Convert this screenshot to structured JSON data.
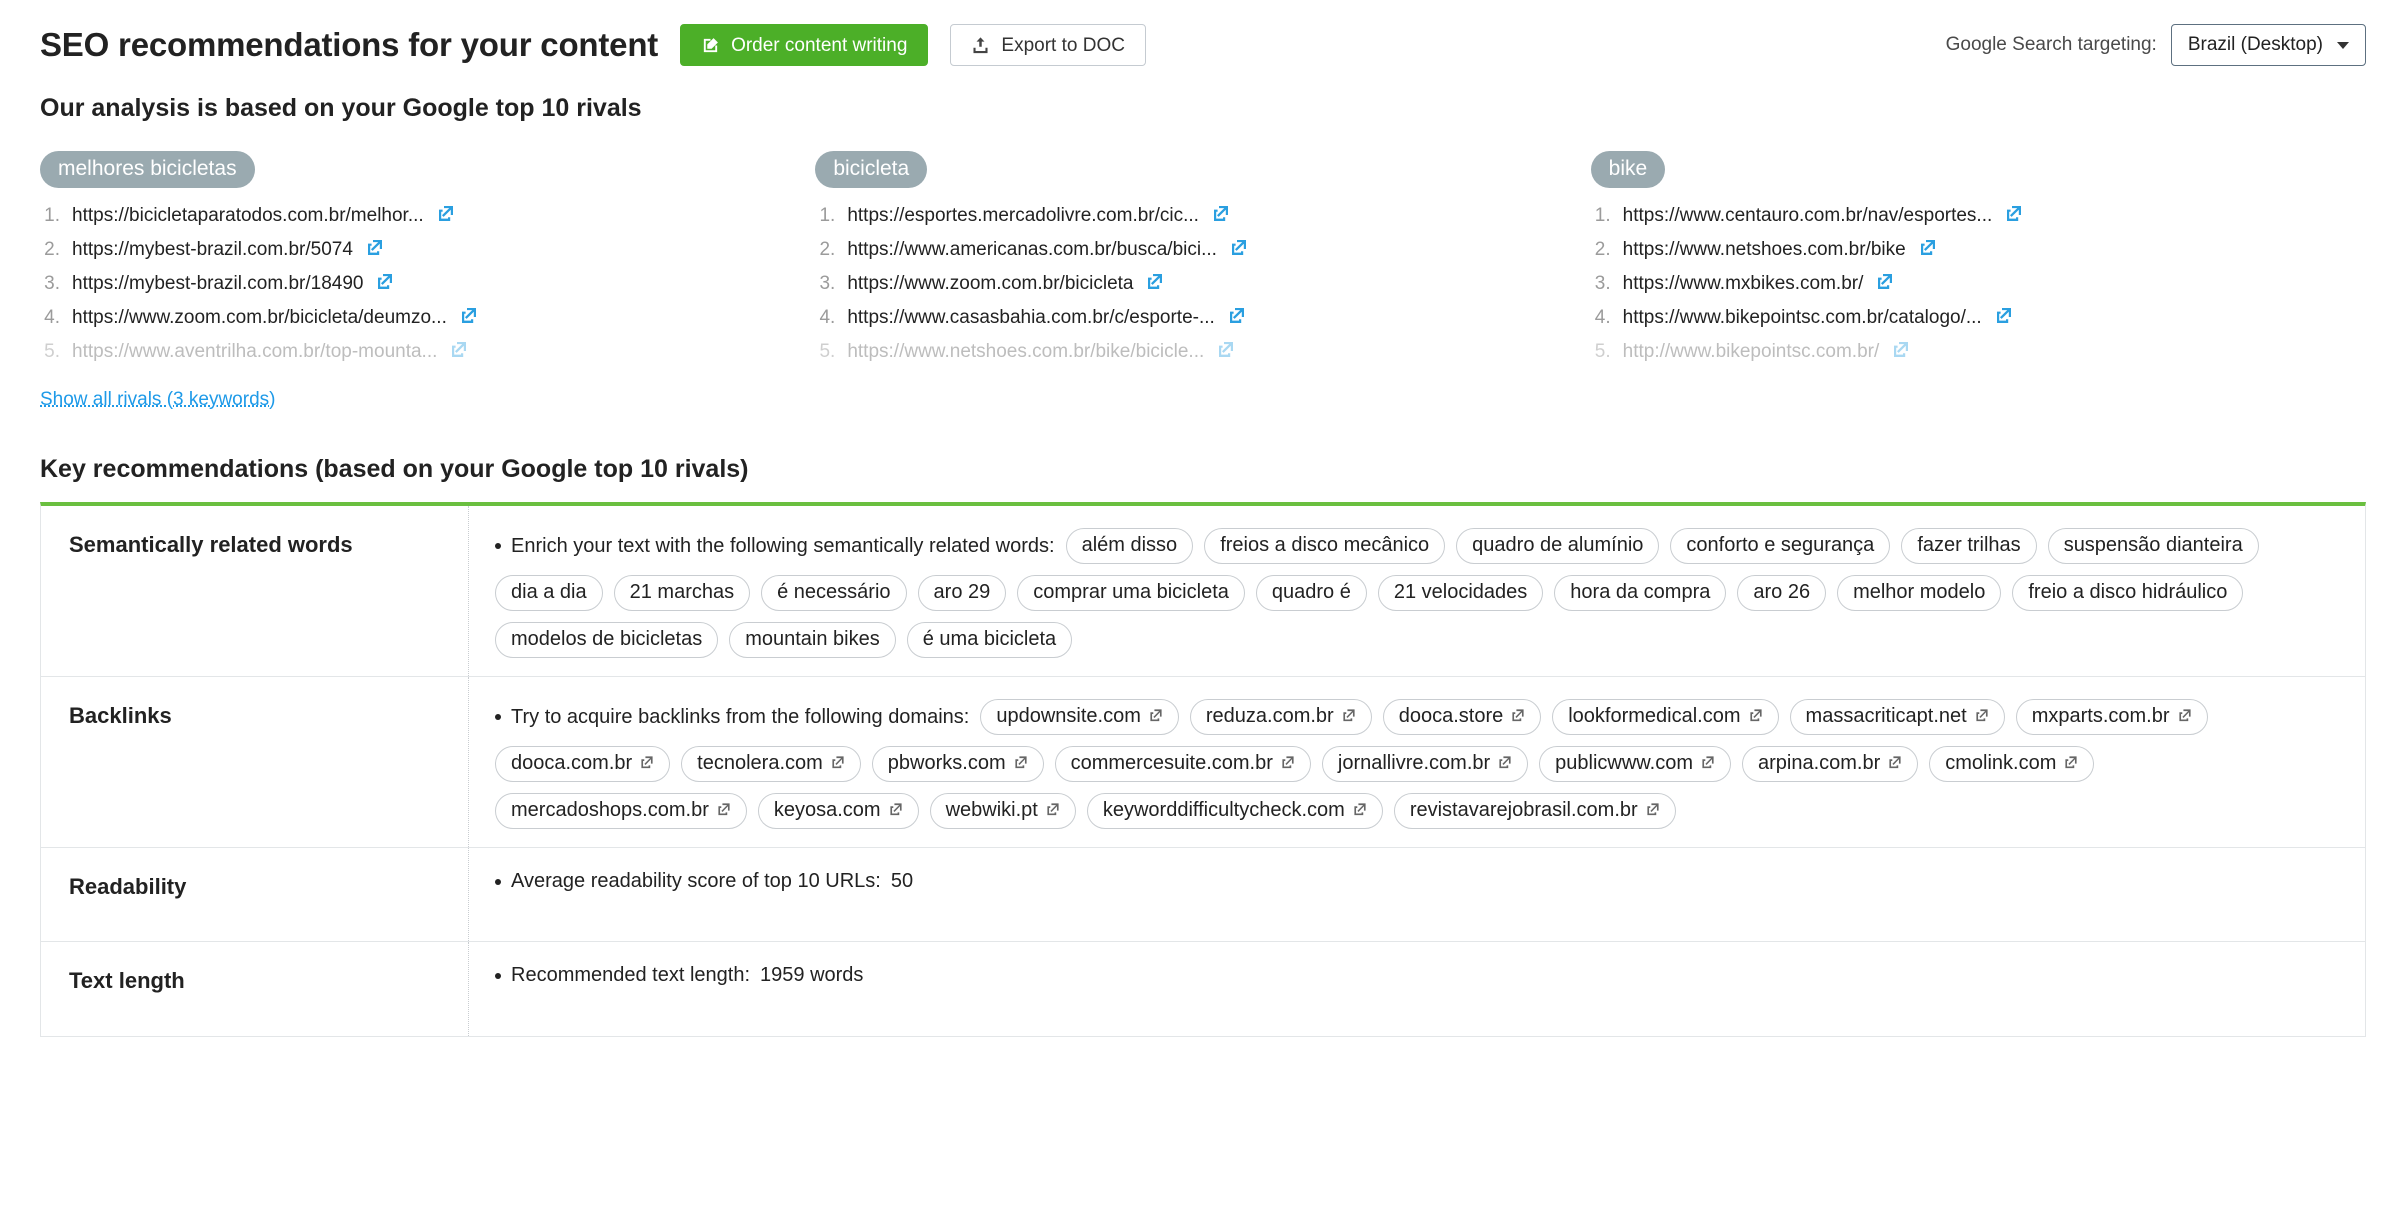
{
  "header": {
    "title": "SEO recommendations for your content",
    "order_button_label": "Order content writing",
    "export_button_label": "Export to DOC",
    "targeting_label": "Google Search targeting:",
    "targeting_value": "Brazil (Desktop)",
    "primary_color": "#4caf28",
    "accent_green": "#6abf3f",
    "link_blue": "#1e9ae8"
  },
  "subtitle": "Our analysis is based on your Google top 10 rivals",
  "show_all_rivals": "Show all rivals (3 keywords)",
  "keyword_groups": [
    {
      "keyword": "melhores bicicletas",
      "urls": [
        {
          "text": "https://bicicletaparatodos.com.br/melhor...",
          "faded": false
        },
        {
          "text": "https://mybest-brazil.com.br/5074",
          "faded": false
        },
        {
          "text": "https://mybest-brazil.com.br/18490",
          "faded": false
        },
        {
          "text": "https://www.zoom.com.br/bicicleta/deumzo...",
          "faded": false
        },
        {
          "text": "https://www.aventrilha.com.br/top-mounta...",
          "faded": true
        }
      ]
    },
    {
      "keyword": "bicicleta",
      "urls": [
        {
          "text": "https://esportes.mercadolivre.com.br/cic...",
          "faded": false
        },
        {
          "text": "https://www.americanas.com.br/busca/bici...",
          "faded": false
        },
        {
          "text": "https://www.zoom.com.br/bicicleta",
          "faded": false
        },
        {
          "text": "https://www.casasbahia.com.br/c/esporte-...",
          "faded": false
        },
        {
          "text": "https://www.netshoes.com.br/bike/bicicle...",
          "faded": true
        }
      ]
    },
    {
      "keyword": "bike",
      "urls": [
        {
          "text": "https://www.centauro.com.br/nav/esportes...",
          "faded": false
        },
        {
          "text": "https://www.netshoes.com.br/bike",
          "faded": false
        },
        {
          "text": "https://www.mxbikes.com.br/",
          "faded": false
        },
        {
          "text": "https://www.bikepointsc.com.br/catalogo/...",
          "faded": false
        },
        {
          "text": "http://www.bikepointsc.com.br/",
          "faded": true
        }
      ]
    }
  ],
  "key_recommendations_title": "Key recommendations (based on your Google top 10 rivals)",
  "recommendations": [
    {
      "label": "Semantically related words",
      "intro": "Enrich your text with the following semantically related words:",
      "tags": [
        "além disso",
        "freios a disco mecânico",
        "quadro de alumínio",
        "conforto e segurança",
        "fazer trilhas",
        "suspensão dianteira",
        "dia a dia",
        "21 marchas",
        "é necessário",
        "aro 29",
        "comprar uma bicicleta",
        "quadro é",
        "21 velocidades",
        "hora da compra",
        "aro 26",
        "melhor modelo",
        "freio a disco hidráulico",
        "modelos de bicicletas",
        "mountain bikes",
        "é uma bicicleta"
      ],
      "tags_have_link_icon": false
    },
    {
      "label": "Backlinks",
      "intro": "Try to acquire backlinks from the following domains:",
      "tags": [
        "updownsite.com",
        "reduza.com.br",
        "dooca.store",
        "lookformedical.com",
        "massacriticapt.net",
        "mxparts.com.br",
        "dooca.com.br",
        "tecnolera.com",
        "pbworks.com",
        "commercesuite.com.br",
        "jornallivre.com.br",
        "publicwww.com",
        "arpina.com.br",
        "cmolink.com",
        "mercadoshops.com.br",
        "keyosa.com",
        "webwiki.pt",
        "keyworddifficultycheck.com",
        "revistavarejobrasil.com.br"
      ],
      "tags_have_link_icon": true
    },
    {
      "label": "Readability",
      "intro": "Average readability score of top 10 URLs:",
      "value": "50",
      "tags": [],
      "tags_have_link_icon": false
    },
    {
      "label": "Text length",
      "intro": "Recommended text length:",
      "value": "1959 words",
      "tags": [],
      "tags_have_link_icon": false
    }
  ]
}
